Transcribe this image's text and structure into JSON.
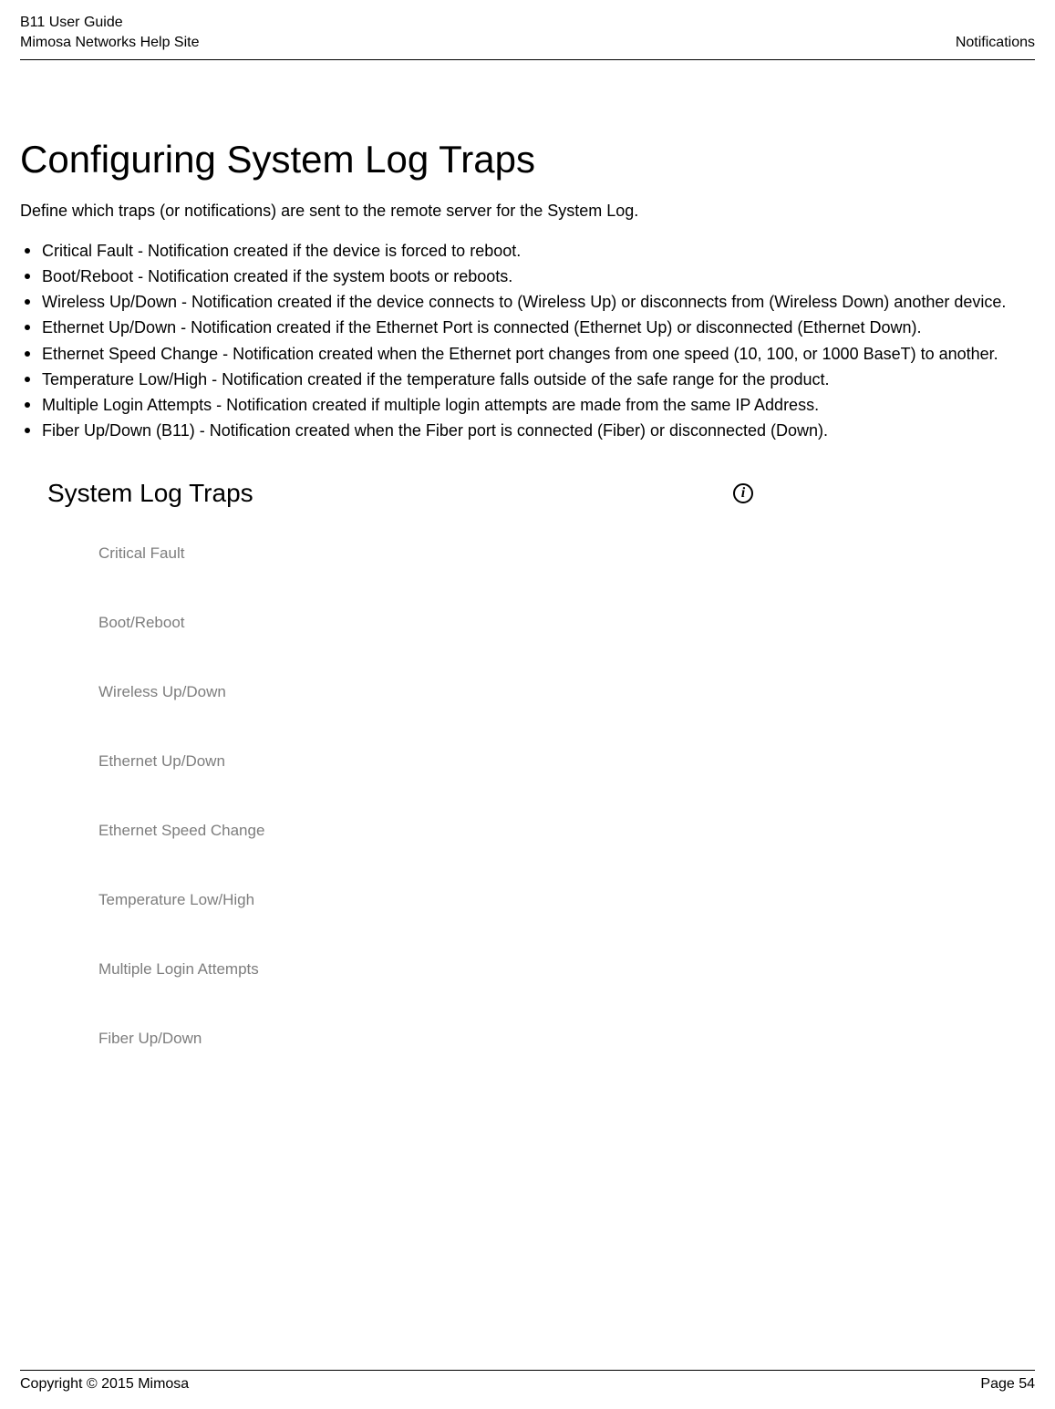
{
  "header": {
    "guide": "B11 User Guide",
    "site": "Mimosa Networks Help Site",
    "section": "Notifications"
  },
  "title": "Configuring System Log Traps",
  "intro": "Define which traps (or notifications) are sent to the remote server for the System Log.",
  "bullets": [
    "Critical Fault - Notification created if the device is forced to reboot.",
    "Boot/Reboot - Notification created if the system boots or reboots.",
    "Wireless Up/Down - Notification created if the device connects to (Wireless Up) or disconnects from (Wireless Down) another device.",
    "Ethernet Up/Down - Notification created if the Ethernet Port is connected (Ethernet Up) or disconnected (Ethernet Down).",
    "Ethernet Speed Change - Notification created when the Ethernet port changes from one speed (10, 100, or 1000 BaseT) to another.",
    "Temperature Low/High - Notification created if the temperature falls outside of the safe range for the product.",
    "Multiple Login Attempts - Notification created if multiple login attempts are made from the same IP Address.",
    "Fiber Up/Down (B11) - Notification created when the Fiber port is connected (Fiber) or disconnected (Down)."
  ],
  "figure": {
    "title": "System Log Traps",
    "info_glyph": "i",
    "traps": [
      "Critical Fault",
      "Boot/Reboot",
      "Wireless Up/Down",
      "Ethernet Up/Down",
      "Ethernet Speed Change",
      "Temperature Low/High",
      "Multiple Login Attempts",
      "Fiber Up/Down"
    ]
  },
  "footer": {
    "copyright": "Copyright © 2015 Mimosa",
    "page": "Page 54"
  }
}
